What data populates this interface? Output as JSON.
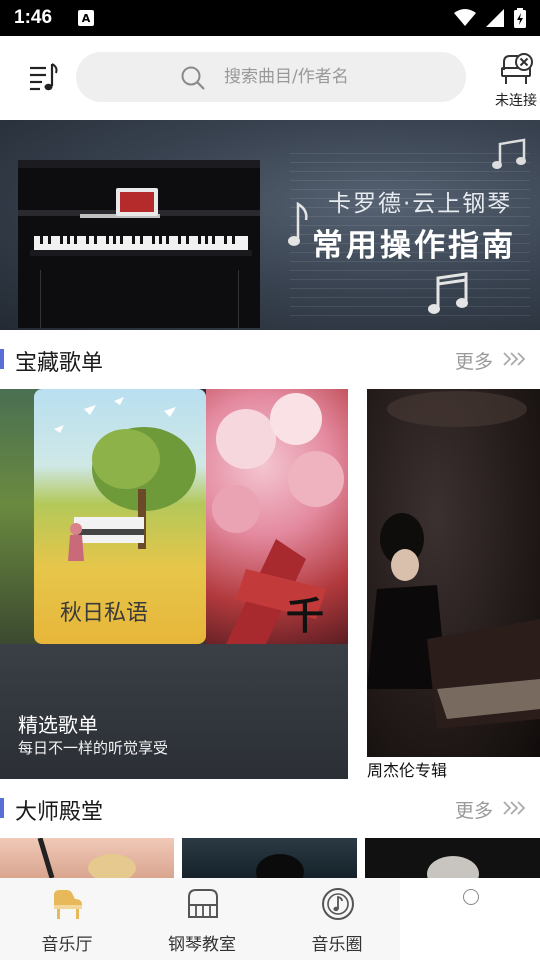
{
  "status_bar": {
    "time": "1:46",
    "notif_icon": "A"
  },
  "header": {
    "menu_icon": "music-list-icon",
    "search_placeholder": "搜索曲目/作者名",
    "piano_status_label": "未连接"
  },
  "banner": {
    "line1": "卡罗德·云上钢琴",
    "line2": "常用操作指南"
  },
  "section_playlists": {
    "title": "宝藏歌单",
    "more": "更多"
  },
  "playlist_card": {
    "title": "精选歌单",
    "subtitle": "每日不一样的听觉享受",
    "cover_text_1": "秋日私语",
    "cover_text_2": "千本"
  },
  "album_card": {
    "label": "周杰伦专辑"
  },
  "section_masters": {
    "title": "大师殿堂",
    "more": "更多"
  },
  "bottom_nav": {
    "items": [
      {
        "label": "音乐厅",
        "icon": "grand-piano-icon",
        "active": true,
        "color": "#e8b95a"
      },
      {
        "label": "钢琴教室",
        "icon": "upright-piano-icon",
        "active": false,
        "color": "#555555"
      },
      {
        "label": "音乐圈",
        "icon": "music-disc-icon",
        "active": false,
        "color": "#555555"
      }
    ]
  },
  "colors": {
    "accent": "#5a6ed8",
    "active_nav": "#e8b95a"
  }
}
